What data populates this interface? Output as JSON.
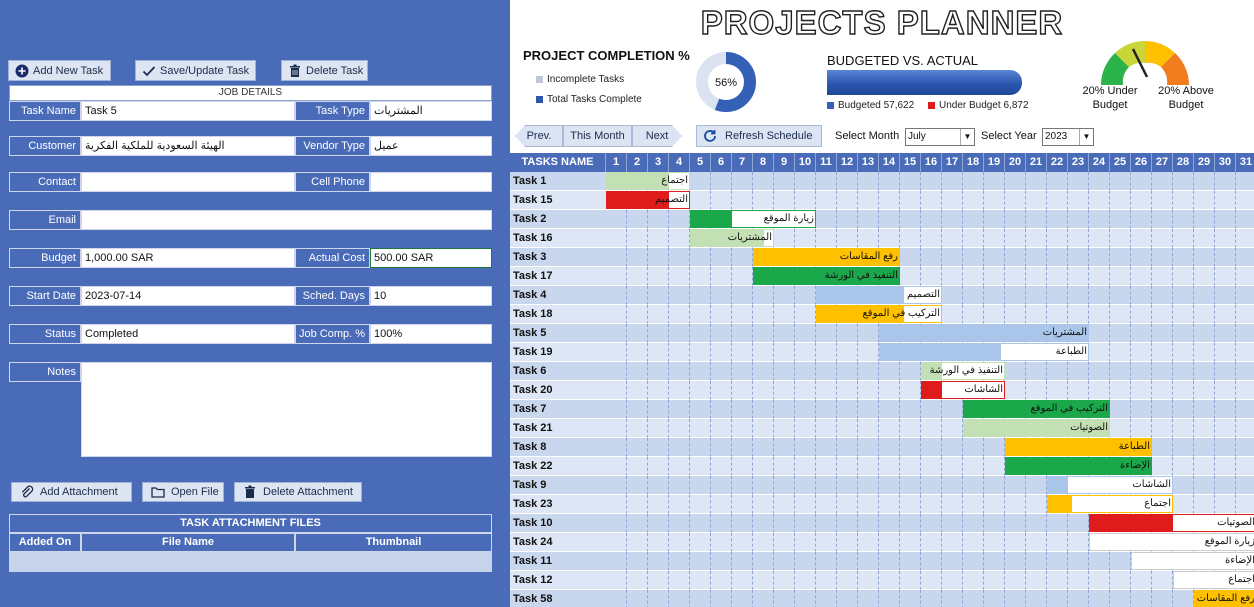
{
  "toolbar": {
    "add_task": "Add New Task",
    "save_task": "Save/Update Task",
    "delete_task": "Delete Task"
  },
  "job_details": {
    "header": "JOB DETAILS",
    "task_name_label": "Task Name",
    "task_name": "Task 5",
    "task_type_label": "Task Type",
    "task_type": "المشتريات",
    "customer_label": "Customer",
    "customer": "الهيئة السعودية للملكية الفكرية",
    "vendor_type_label": "Vendor Type",
    "vendor_type": "عميل",
    "contact_label": "Contact",
    "contact": "",
    "cell_phone_label": "Cell Phone",
    "cell_phone": "",
    "email_label": "Email",
    "email": "",
    "budget_label": "Budget",
    "budget": "1,000.00 SAR",
    "actual_cost_label": "Actual Cost",
    "actual_cost": "500.00 SAR",
    "start_date_label": "Start Date",
    "start_date": "2023-07-14",
    "sched_days_label": "Sched. Days",
    "sched_days": "10",
    "status_label": "Status",
    "status": "Completed",
    "job_comp_label": "Job Comp. %",
    "job_comp": "100%",
    "notes_label": "Notes",
    "notes": ""
  },
  "attachments": {
    "add": "Add Attachment",
    "open": "Open File",
    "delete": "Delete Attachment",
    "title": "TASK ATTACHMENT FILES",
    "columns": [
      "Added On",
      "File Name",
      "Thumbnail"
    ]
  },
  "dashboard": {
    "title": "PROJECTS PLANNER",
    "completion_title": "PROJECT COMPLETION %",
    "legend_incomplete": "Incomplete Tasks",
    "legend_complete": "Total Tasks Complete",
    "completion_pct": "56%",
    "completion_value": 0.56,
    "budget_title": "BUDGETED VS. ACTUAL",
    "budgeted_label": "Budgeted 57,622",
    "under_budget_label": "Under Budget 6,872",
    "gauge_under": "20% Under Budget",
    "gauge_above": "20% Above Budget",
    "colors": {
      "primary": "#4a6bb8",
      "dark_blue": "#2f56a8",
      "red": "#e01b1b",
      "green": "#1aa84b",
      "light_green": "#c3e0b4",
      "orange": "#ffc000",
      "light_blue": "#a9c6ea"
    }
  },
  "nav": {
    "prev": "Prev.",
    "this_month": "This Month",
    "next": "Next",
    "refresh": "Refresh Schedule",
    "select_month_label": "Select Month",
    "month": "July",
    "select_year_label": "Select Year",
    "year": "2023"
  },
  "gantt": {
    "header": "TASKS NAME",
    "days": [
      "1",
      "2",
      "3",
      "4",
      "5",
      "6",
      "7",
      "8",
      "9",
      "10",
      "11",
      "12",
      "13",
      "14",
      "15",
      "16",
      "17",
      "18",
      "19",
      "20",
      "21",
      "22",
      "23",
      "24",
      "25",
      "26",
      "27",
      "28",
      "29",
      "30",
      "31"
    ],
    "rows": [
      {
        "name": "Task 1",
        "start": 1,
        "end": 4,
        "fill": 3,
        "color": "#c3e0b4",
        "label": "اجتماع",
        "outline": "#c3e0b4"
      },
      {
        "name": "Task 15",
        "start": 1,
        "end": 4,
        "fill": 3,
        "color": "#e01b1b",
        "label": "التصميم",
        "outline": "#e01b1b"
      },
      {
        "name": "Task 2",
        "start": 5,
        "end": 10,
        "fill": 2,
        "color": "#1aa84b",
        "label": "زيارة الموقع",
        "outline": "#1aa84b"
      },
      {
        "name": "Task 16",
        "start": 5,
        "end": 8,
        "fill": 3.5,
        "color": "#c3e0b4",
        "label": "المشتريات",
        "outline": "#c3e0b4"
      },
      {
        "name": "Task 3",
        "start": 8,
        "end": 14,
        "fill": 7,
        "color": "#ffc000",
        "label": "رفع المقاسات",
        "outline": "#ffc000"
      },
      {
        "name": "Task 17",
        "start": 8,
        "end": 14,
        "fill": 7,
        "color": "#1aa84b",
        "label": "التنفيذ في الورشة",
        "outline": "#1aa84b"
      },
      {
        "name": "Task 4",
        "start": 11,
        "end": 16,
        "fill": 4.2,
        "color": "#a9c6ea",
        "label": "التصميم",
        "outline": "#a9c6ea"
      },
      {
        "name": "Task 18",
        "start": 11,
        "end": 16,
        "fill": 4.2,
        "color": "#ffc000",
        "label": "التركيب في الموقع",
        "outline": "#ffc000"
      },
      {
        "name": "Task 5",
        "start": 14,
        "end": 23,
        "fill": 10,
        "color": "#a9c6ea",
        "label": "المشتريات",
        "outline": "#a9c6ea"
      },
      {
        "name": "Task 19",
        "start": 14,
        "end": 23,
        "fill": 5.8,
        "color": "#a9c6ea",
        "label": "الطباعة",
        "outline": "#a9c6ea"
      },
      {
        "name": "Task 6",
        "start": 16,
        "end": 19,
        "fill": 1,
        "color": "#c3e0b4",
        "label": "التنفيذ في الورشة",
        "outline": "#c3e0b4"
      },
      {
        "name": "Task 20",
        "start": 16,
        "end": 19,
        "fill": 1,
        "color": "#e01b1b",
        "label": "الشاشات",
        "outline": "#e01b1b"
      },
      {
        "name": "Task 7",
        "start": 18,
        "end": 24,
        "fill": 7,
        "color": "#1aa84b",
        "label": "التركيب في الموقع",
        "outline": "#1aa84b"
      },
      {
        "name": "Task 21",
        "start": 18,
        "end": 24,
        "fill": 7,
        "color": "#c3e0b4",
        "label": "الصوتيات",
        "outline": "#c3e0b4"
      },
      {
        "name": "Task 8",
        "start": 20,
        "end": 26,
        "fill": 7,
        "color": "#ffc000",
        "label": "الطباعة",
        "outline": "#ffc000"
      },
      {
        "name": "Task 22",
        "start": 20,
        "end": 26,
        "fill": 7,
        "color": "#1aa84b",
        "label": "الإضاءة",
        "outline": "#1aa84b"
      },
      {
        "name": "Task 9",
        "start": 22,
        "end": 27,
        "fill": 1,
        "color": "#a9c6ea",
        "label": "الشاشات",
        "outline": "#a9c6ea"
      },
      {
        "name": "Task 23",
        "start": 22,
        "end": 27,
        "fill": 1.2,
        "color": "#ffc000",
        "label": "اجتماع",
        "outline": "#ffc000"
      },
      {
        "name": "Task 10",
        "start": 24,
        "end": 31,
        "fill": 4,
        "color": "#e01b1b",
        "label": "الصوتيات",
        "outline": "#e01b1b"
      },
      {
        "name": "Task 24",
        "start": 24,
        "end": 31,
        "fill": 0,
        "color": "#ffffff",
        "label": "زيارة الموقع",
        "outline": "#cccccc"
      },
      {
        "name": "Task 11",
        "start": 26,
        "end": 31,
        "fill": 0,
        "color": "#ffffff",
        "label": "الإضاءة",
        "outline": "#cccccc"
      },
      {
        "name": "Task 12",
        "start": 28,
        "end": 31,
        "fill": 0,
        "color": "#ffffff",
        "label": "اجتماع",
        "outline": "#cccccc"
      },
      {
        "name": "Task 58",
        "start": 29,
        "end": 31,
        "fill": 3,
        "color": "#ffc000",
        "label": "رفع المقاسات",
        "outline": "#ffc000"
      }
    ]
  }
}
